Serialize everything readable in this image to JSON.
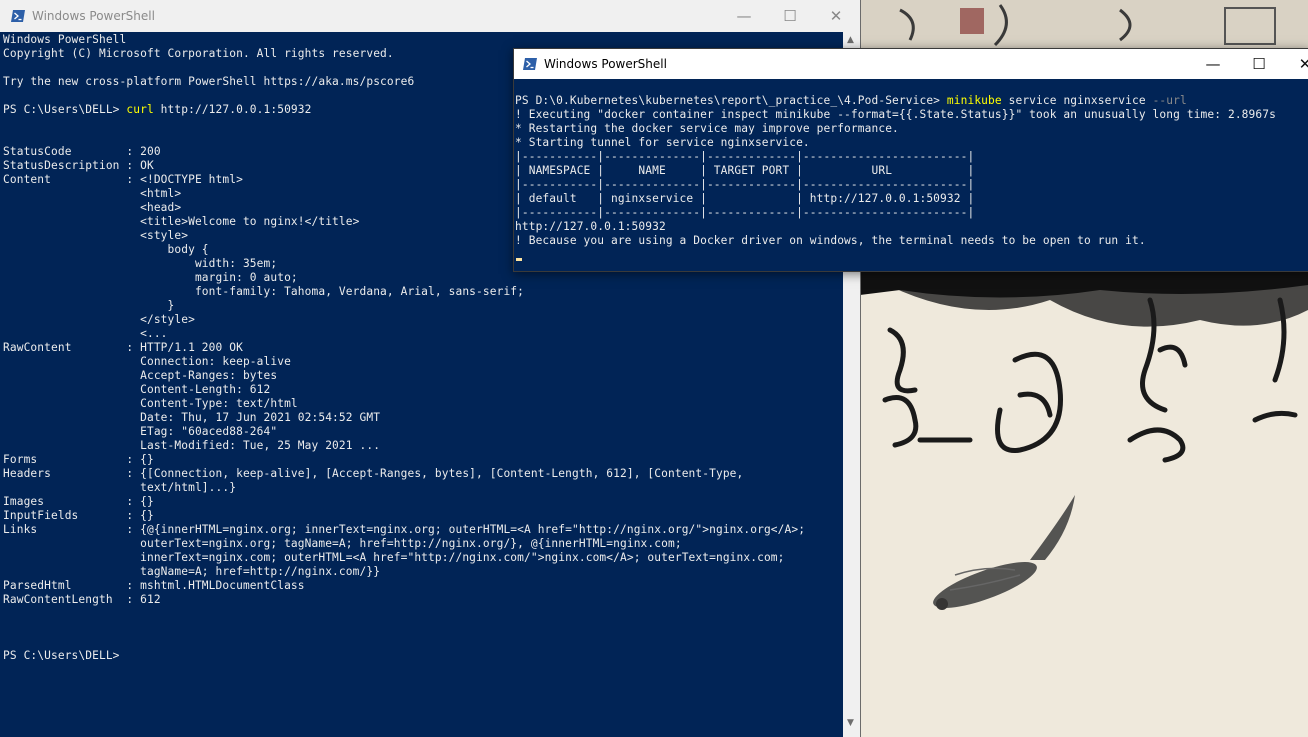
{
  "window_back": {
    "title": "Windows PowerShell",
    "lines": [
      "Windows PowerShell",
      "Copyright (C) Microsoft Corporation. All rights reserved.",
      "",
      "Try the new cross-platform PowerShell https://aka.ms/pscore6",
      "",
      "PS C:\\Users\\DELL> ",
      "",
      "",
      "StatusCode        : 200",
      "StatusDescription : OK",
      "Content           : <!DOCTYPE html>",
      "                    <html>",
      "                    <head>",
      "                    <title>Welcome to nginx!</title>",
      "                    <style>",
      "                        body {",
      "                            width: 35em;",
      "                            margin: 0 auto;",
      "                            font-family: Tahoma, Verdana, Arial, sans-serif;",
      "                        }",
      "                    </style>",
      "                    <...",
      "RawContent        : HTTP/1.1 200 OK",
      "                    Connection: keep-alive",
      "                    Accept-Ranges: bytes",
      "                    Content-Length: 612",
      "                    Content-Type: text/html",
      "                    Date: Thu, 17 Jun 2021 02:54:52 GMT",
      "                    ETag: \"60aced88-264\"",
      "                    Last-Modified: Tue, 25 May 2021 ...",
      "Forms             : {}",
      "Headers           : {[Connection, keep-alive], [Accept-Ranges, bytes], [Content-Length, 612], [Content-Type,",
      "                    text/html]...}",
      "Images            : {}",
      "InputFields       : {}",
      "Links             : {@{innerHTML=nginx.org; innerText=nginx.org; outerHTML=<A href=\"http://nginx.org/\">nginx.org</A>;",
      "                    outerText=nginx.org; tagName=A; href=http://nginx.org/}, @{innerHTML=nginx.com;",
      "                    innerText=nginx.com; outerHTML=<A href=\"http://nginx.com/\">nginx.com</A>; outerText=nginx.com;",
      "                    tagName=A; href=http://nginx.com/}}",
      "ParsedHtml        : mshtml.HTMLDocumentClass",
      "RawContentLength  : 612",
      "",
      "",
      "",
      "PS C:\\Users\\DELL>"
    ],
    "command_keyword": "curl",
    "command_arg": " http://127.0.0.1:50932"
  },
  "window_front": {
    "title": "Windows PowerShell",
    "prompt": "PS D:\\0.Kubernetes\\kubernetes\\report\\_practice_\\4.Pod-Service> ",
    "cmd_keyword": "minikube",
    "cmd_args": " service nginxservice ",
    "cmd_flag": "--url",
    "lines": [
      "! Executing \"docker container inspect minikube --format={{.State.Status}}\" took an unusually long time: 2.8967s",
      "* Restarting the docker service may improve performance.",
      "* Starting tunnel for service nginxservice.",
      "|-----------|--------------|-------------|------------------------|",
      "| NAMESPACE |     NAME     | TARGET PORT |          URL           |",
      "|-----------|--------------|-------------|------------------------|",
      "| default   | nginxservice |             | http://127.0.0.1:50932 |",
      "|-----------|--------------|-------------|------------------------|",
      "http://127.0.0.1:50932",
      "! Because you are using a Docker driver on windows, the terminal needs to be open to run it."
    ]
  },
  "caption": {
    "minimize": "—",
    "maximize": "☐",
    "close": "✕"
  },
  "colors": {
    "console_bg": "#012456",
    "console_text": "#ececec",
    "command": "#ffff00",
    "flag": "#8a8a8a"
  }
}
